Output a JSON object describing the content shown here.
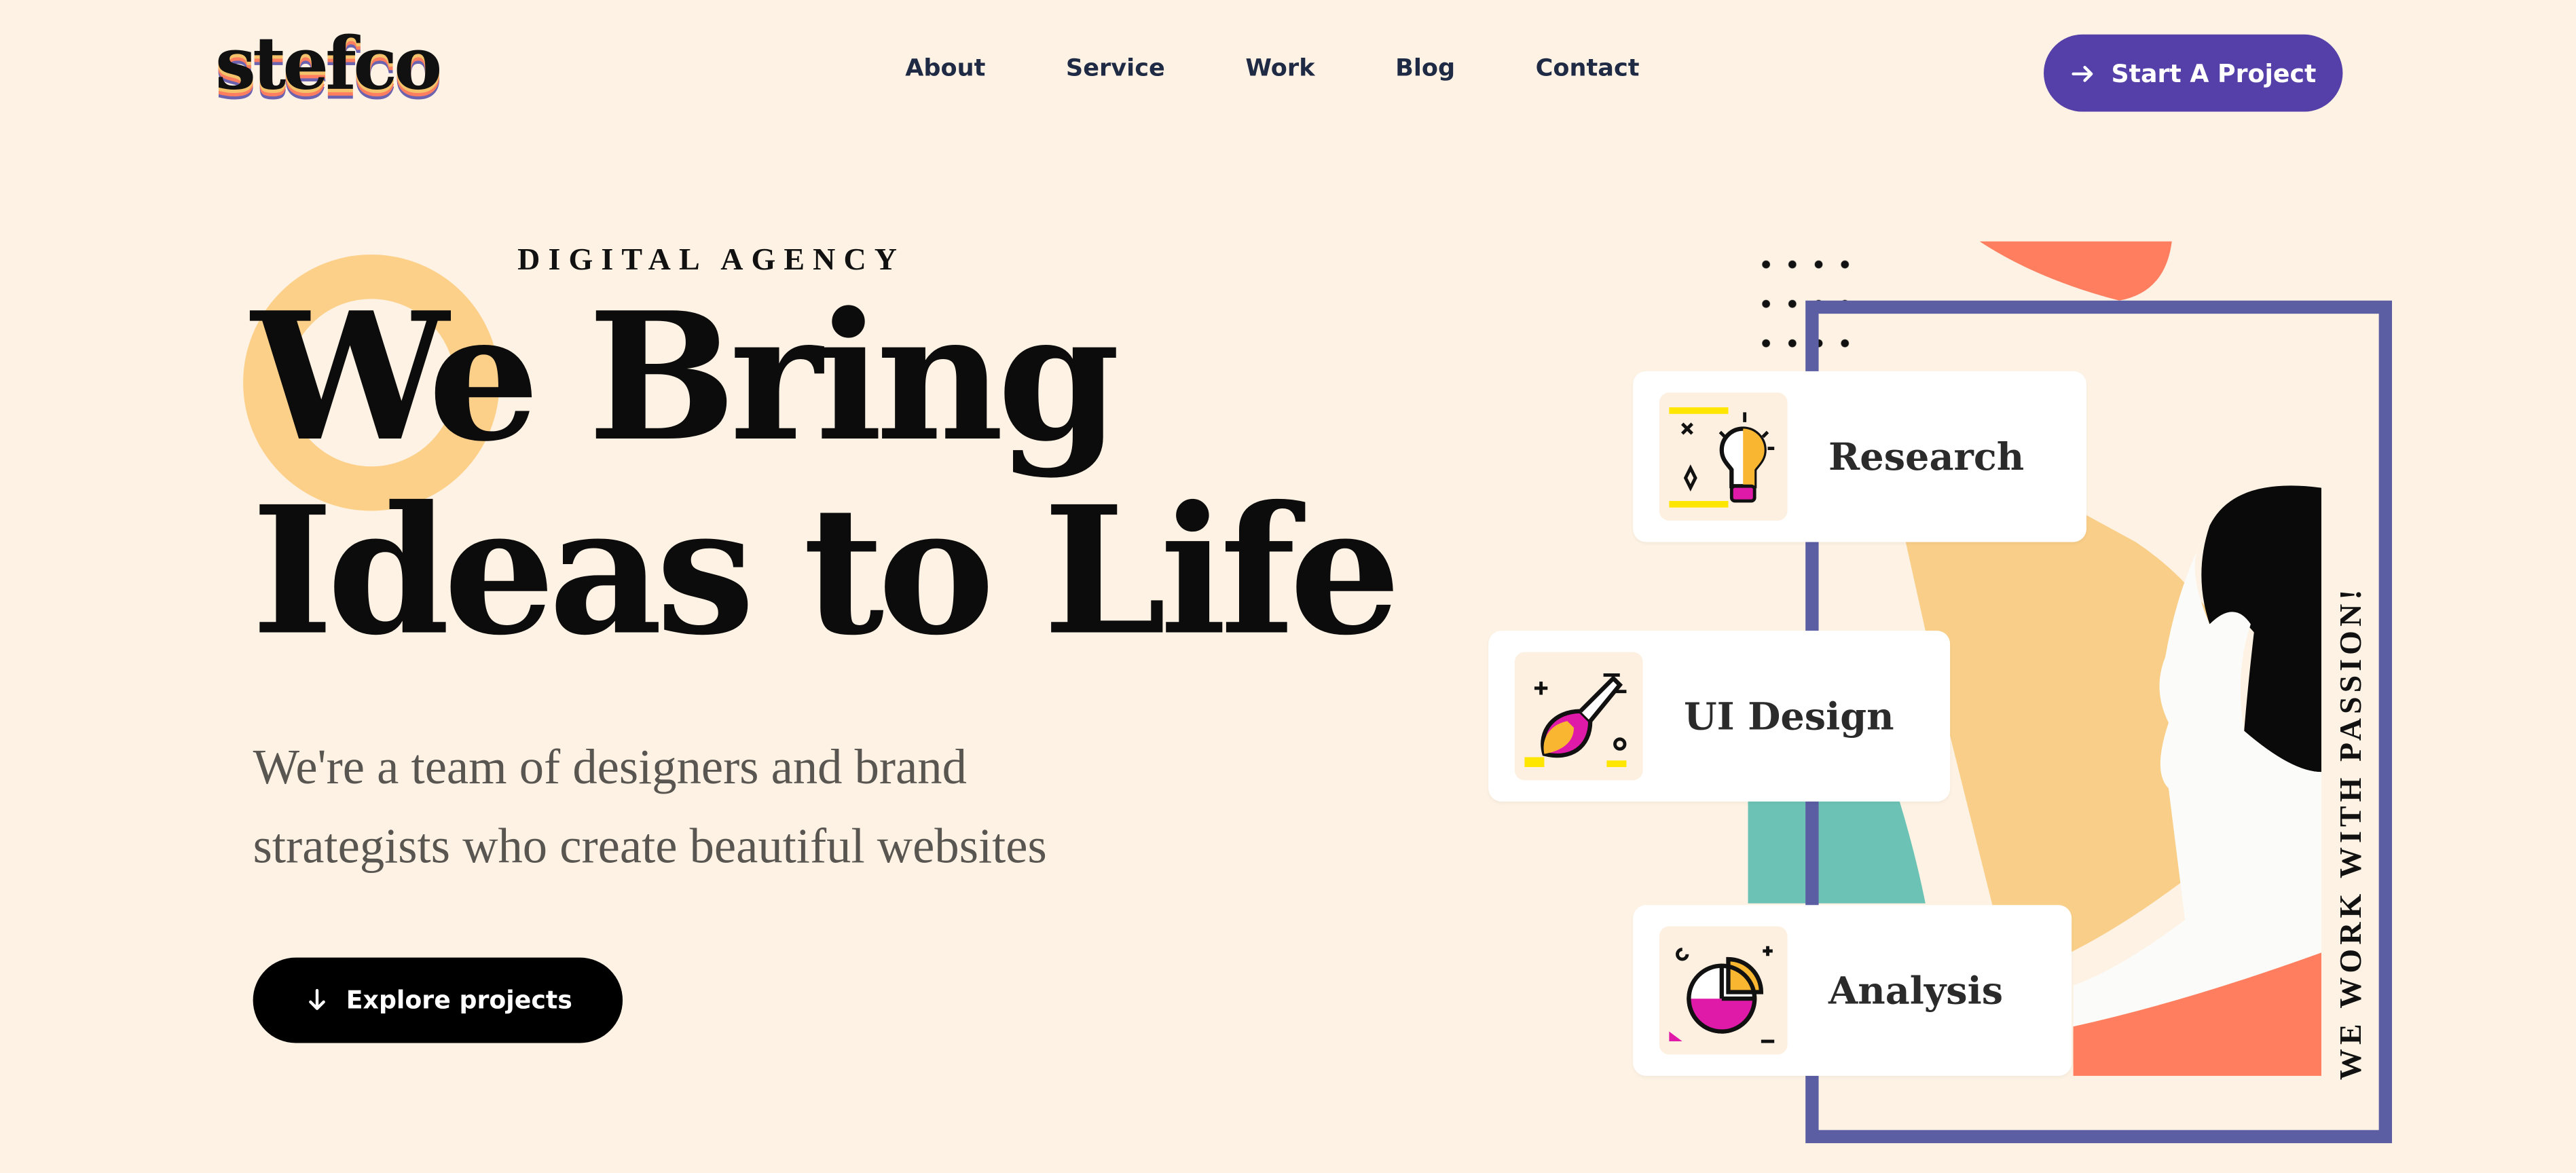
{
  "brand": {
    "logo": "stefco"
  },
  "nav": {
    "items": [
      "About",
      "Service",
      "Work",
      "Blog",
      "Contact"
    ]
  },
  "header": {
    "cta_label": "Start A Project"
  },
  "hero": {
    "eyebrow": "DIGITAL AGENCY",
    "headline_line1": "We Bring",
    "headline_line2": "Ideas to Life",
    "subtitle": "We're a team of designers and brand strategists who create beautiful websites",
    "explore_label": "Explore projects"
  },
  "illustration": {
    "vertical_text": "WE WORK WITH PASSION!",
    "cards": [
      {
        "label": "Research",
        "icon": "lightbulb-icon"
      },
      {
        "label": "UI Design",
        "icon": "paintbrush-icon"
      },
      {
        "label": "Analysis",
        "icon": "pie-chart-icon"
      }
    ]
  },
  "colors": {
    "background": "#fdf2e3",
    "accent_purple": "#5440a8",
    "ring_yellow": "#fdd08a",
    "coral": "#ff7e5f",
    "teal": "#6cc3b5",
    "frame": "#5b5ea3"
  }
}
